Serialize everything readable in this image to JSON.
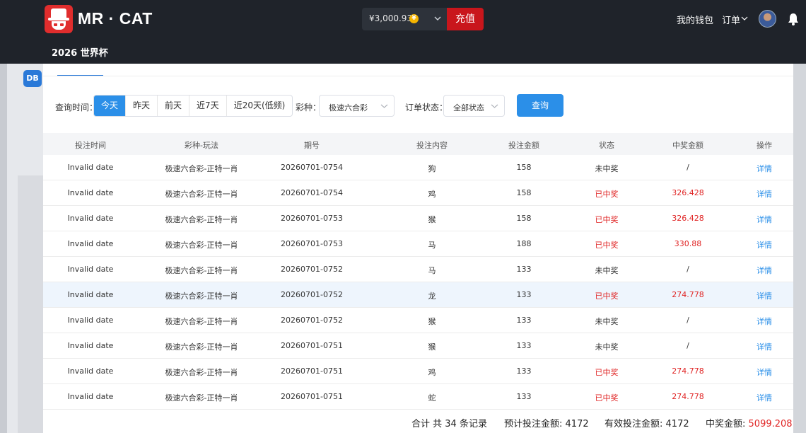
{
  "header": {
    "brand": "MR · CAT",
    "sublink": "2026 世界杯",
    "balance": "¥3,000.93",
    "coin_symbol": "¥",
    "recharge": "充值",
    "wallet": "我的钱包",
    "orders": "订单"
  },
  "background": {
    "db_badge": "DB"
  },
  "filter": {
    "time_label": "查询时间：",
    "time_options": [
      "今天",
      "昨天",
      "前天",
      "近7天",
      "近20天(低频)"
    ],
    "active_time": "今天",
    "lottery_label": "彩种：",
    "lottery_value": "极速六合彩",
    "status_label": "订单状态：",
    "status_value": "全部状态",
    "query": "查询"
  },
  "table": {
    "columns": [
      "投注时间",
      "彩种-玩法",
      "期号",
      "投注内容",
      "投注金额",
      "状态",
      "中奖金额",
      "操作"
    ],
    "rows": [
      [
        "Invalid date",
        "极速六合彩-正特一肖",
        "20260701-0754",
        "狗",
        "158",
        "未中奖",
        "/",
        "详情"
      ],
      [
        "Invalid date",
        "极速六合彩-正特一肖",
        "20260701-0754",
        "鸡",
        "158",
        "已中奖",
        "326.428",
        "详情"
      ],
      [
        "Invalid date",
        "极速六合彩-正特一肖",
        "20260701-0753",
        "猴",
        "158",
        "已中奖",
        "326.428",
        "详情"
      ],
      [
        "Invalid date",
        "极速六合彩-正特一肖",
        "20260701-0753",
        "马",
        "188",
        "已中奖",
        "330.88",
        "详情"
      ],
      [
        "Invalid date",
        "极速六合彩-正特一肖",
        "20260701-0752",
        "马",
        "133",
        "未中奖",
        "/",
        "详情"
      ],
      [
        "Invalid date",
        "极速六合彩-正特一肖",
        "20260701-0752",
        "龙",
        "133",
        "已中奖",
        "274.778",
        "详情"
      ],
      [
        "Invalid date",
        "极速六合彩-正特一肖",
        "20260701-0752",
        "猴",
        "133",
        "未中奖",
        "/",
        "详情"
      ],
      [
        "Invalid date",
        "极速六合彩-正特一肖",
        "20260701-0751",
        "猴",
        "133",
        "未中奖",
        "/",
        "详情"
      ],
      [
        "Invalid date",
        "极速六合彩-正特一肖",
        "20260701-0751",
        "鸡",
        "133",
        "已中奖",
        "274.778",
        "详情"
      ],
      [
        "Invalid date",
        "极速六合彩-正特一肖",
        "20260701-0751",
        "蛇",
        "133",
        "已中奖",
        "274.778",
        "详情"
      ]
    ],
    "won_status": "已中奖",
    "highlighted_row": 5
  },
  "summary": {
    "total": "合计 共 34 条记录",
    "expected_label": "预计投注金额:",
    "expected_value": "4172",
    "valid_label": "有效投注金额:",
    "valid_value": "4172",
    "win_label": "中奖金额:",
    "win_value": "5099.208"
  },
  "colors": {
    "nav_bg": "#1f232a",
    "primary": "#2b8fe8",
    "danger": "#e02525",
    "recharge": "#c9161c",
    "coin": "#f4b400"
  }
}
